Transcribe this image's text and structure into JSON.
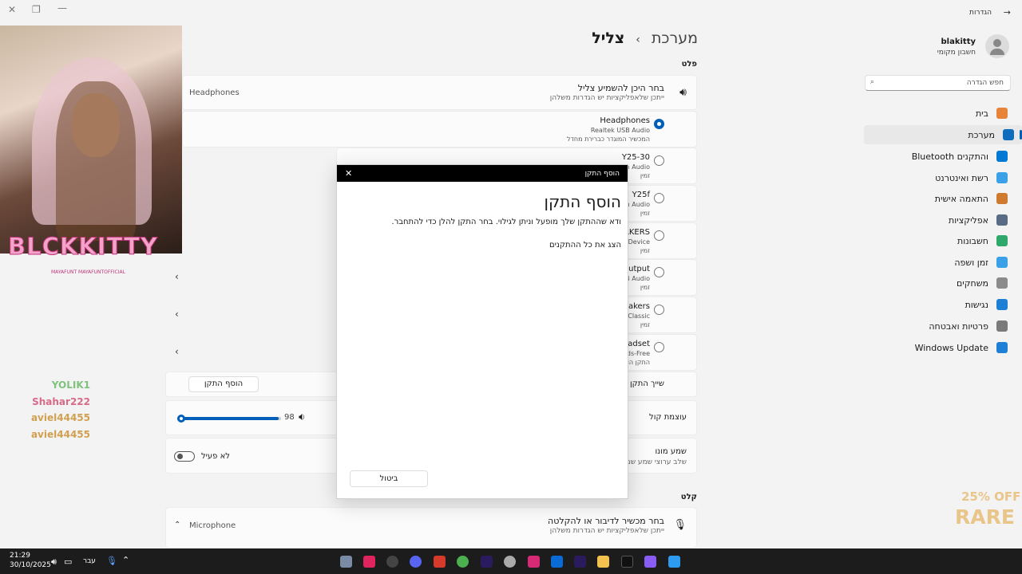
{
  "window": {
    "back_label": "הגדרות"
  },
  "user": {
    "name": "blakitty",
    "account_type": "חשבון מקומי"
  },
  "search": {
    "placeholder": "חפש הגדרה"
  },
  "sidebar": {
    "items": [
      {
        "label": "בית",
        "color": "#e8833a"
      },
      {
        "label": "מערכת",
        "color": "#0f6cbd"
      },
      {
        "label": "Bluetooth והתקנים",
        "color": "#0078d4"
      },
      {
        "label": "רשת ואינטרנט",
        "color": "#3aa0e8"
      },
      {
        "label": "התאמה אישית",
        "color": "#d07a30"
      },
      {
        "label": "אפליקציות",
        "color": "#5a6c85"
      },
      {
        "label": "חשבונות",
        "color": "#2fa86b"
      },
      {
        "label": "זמן ושפה",
        "color": "#3aa0e8"
      },
      {
        "label": "משחקים",
        "color": "#8a8a8a"
      },
      {
        "label": "נגישות",
        "color": "#1d7fd6"
      },
      {
        "label": "פרטיות ואבטחה",
        "color": "#7a7a7a"
      },
      {
        "label": "Windows Update",
        "color": "#1d7fd6"
      }
    ]
  },
  "breadcrumb": {
    "parent": "מערכת",
    "separator": "›",
    "current": "צליל"
  },
  "output": {
    "section_label": "פלט",
    "choose_title": "בחר היכן להשמיע צליל",
    "choose_sub": "ייתכן שלאפליקציות יש הגדרות משלהן",
    "selected_device": "Headphones",
    "devices": [
      {
        "name": "Headphones",
        "line2": "Realtek USB Audio",
        "line3": "המכשיר המוגדר כברירת מחדל",
        "selected": true
      },
      {
        "name": "Y25-30",
        "line2": "n Audio",
        "line3": "זמין",
        "selected": false
      },
      {
        "name": "Y25f",
        "line2": "n Audio",
        "line3": "זמין",
        "selected": false
      },
      {
        "name": "EAKERS",
        "line2": "Device",
        "line3": "זמין",
        "selected": false
      },
      {
        "name": "Output",
        "line2": "B Audio",
        "line3": "זמין",
        "selected": false
      },
      {
        "name": "eakers",
        "line2": "Classic",
        "line3": "זמין",
        "selected": false
      },
      {
        "name": "eadset",
        "line2": "ds-Free",
        "line3": "התקן הו",
        "selected": false
      }
    ],
    "pair_label": "שייך התקן",
    "add_device_button": "הוסף התקן",
    "volume_label": "עוצמת קול",
    "volume_value": "98",
    "volume_level": 0.98,
    "mono_label": "שמע מונו",
    "mono_sub": "שלב ערוצי שמע שמאל",
    "mono_state": "לא פעיל"
  },
  "input": {
    "section_label": "קלט",
    "choose_title": "בחר מכשיר לדיבור או להקלטה",
    "choose_sub": "ייתכן שלאפליקציות יש הגדרות משלהן",
    "selected_device": "Microphone"
  },
  "modal": {
    "bar_title": "הוסף התקן",
    "heading": "הוסף התקן",
    "description": "ודא שההתקן שלך מופעל וניתן לגילוי. בחר התקן להלן כדי להתחבר.",
    "show_all": "הצג את כל ההתקנים",
    "cancel": "ביטול"
  },
  "stream": {
    "streamer_name": "BLCKKITTY",
    "socials": "MAYAFUNT  MAYAFUNTOFFICIAL",
    "chat": [
      {
        "user": "YOLIK1",
        "color": "#7ec27e"
      },
      {
        "user": "Shahar222",
        "color": "#d86a8a"
      },
      {
        "user": "aviel44455",
        "color": "#d0a050"
      },
      {
        "user": "aviel44455",
        "color": "#d0a050"
      }
    ],
    "promo_line1": "25% OFF",
    "promo_line2": "RARE"
  },
  "taskbar": {
    "time": "21:29",
    "date": "30/10/2025",
    "language": "עבר"
  }
}
